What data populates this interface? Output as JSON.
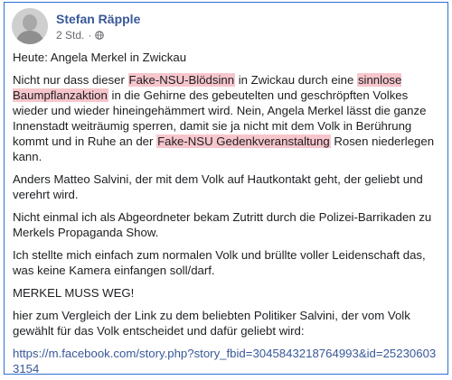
{
  "post": {
    "author": "Stefan Räpple",
    "time": "2 Std.",
    "separator": "·",
    "privacy_icon": "globe-icon",
    "paragraphs": {
      "p1": "Heute: Angela Merkel in Zwickau",
      "p2": {
        "t1": "Nicht nur dass dieser ",
        "h1": "Fake-NSU-Blödsinn",
        "t2": " in Zwickau durch eine ",
        "h2": "sinnlose Baumpflanzaktion",
        "t3": " in die Gehirne des gebeutelten und geschröpften Volkes wieder und wieder hineingehämmert wird. Nein, Angela Merkel lässt die ganze Innenstadt weiträumig sperren, damit sie ja nicht mit dem Volk in Berührung kommt und in Ruhe an der ",
        "h3": "Fake-NSU Gedenkveranstaltung",
        "t4": " Rosen niederlegen kann."
      },
      "p3": "Anders Matteo Salvini, der mit dem Volk auf Hautkontakt geht, der geliebt und verehrt wird.",
      "p4": "Nicht einmal ich als Abgeordneter bekam Zutritt durch die Polizei-Barrikaden zu Merkels Propaganda Show.",
      "p5": "Ich stellte mich einfach zum normalen Volk und brüllte voller Leidenschaft das, was keine Kamera einfangen soll/darf.",
      "p6": "MERKEL MUSS WEG!",
      "p7": "hier zum Vergleich der Link zu dem beliebten Politiker Salvini, der vom Volk gewählt für das Volk entscheidet und dafür geliebt wird:",
      "link": "https://m.facebook.com/story.php?story_fbid=3045843218764993&id=252306033154"
    },
    "colors": {
      "author": "#385898",
      "highlight": "#f7c6cc",
      "border": "#2f6fd6"
    }
  }
}
